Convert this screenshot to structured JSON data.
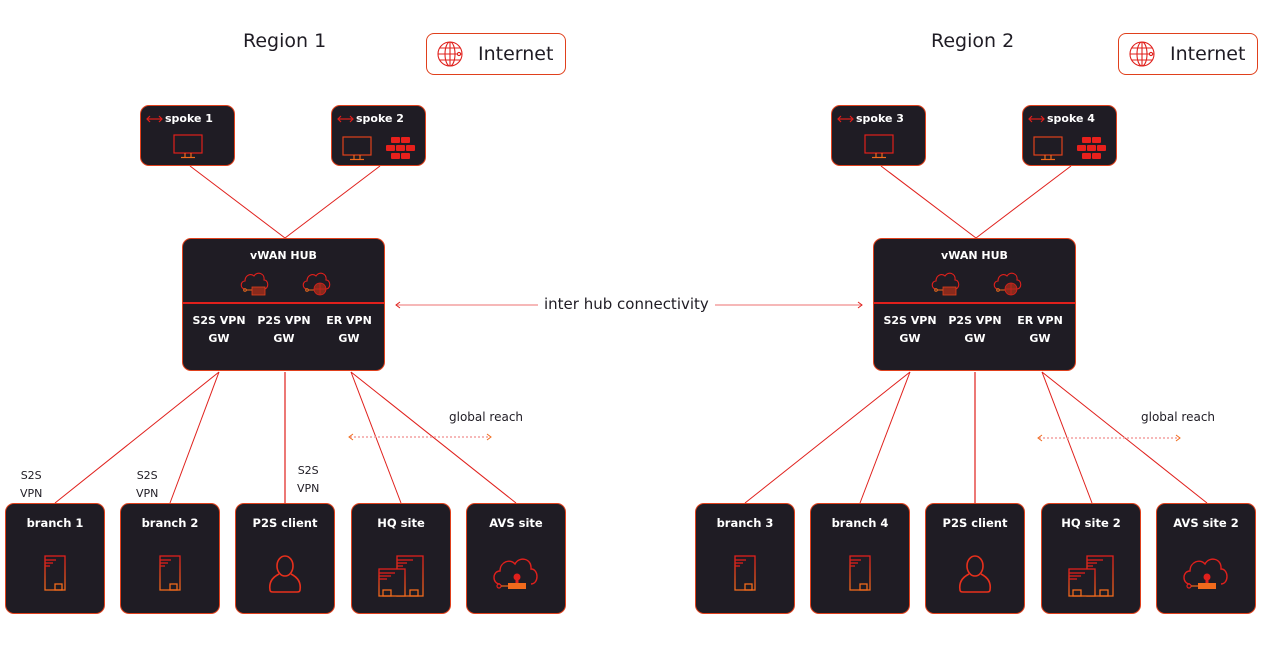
{
  "colors": {
    "accent": "#e0201c",
    "accent_orange": "#f06a1c",
    "box_bg": "#1f1c24",
    "text_dark": "#1f1c24",
    "dotted": "#f4a0a0"
  },
  "inter_hub_label": "inter hub connectivity",
  "regions": [
    {
      "title": "Region 1",
      "internet": {
        "label": "Internet",
        "icon": "globe-icon"
      },
      "spokes": [
        {
          "label": "spoke 1",
          "icons": [
            "monitor-icon"
          ]
        },
        {
          "label": "spoke 2",
          "icons": [
            "monitor-icon",
            "firewall-icon"
          ]
        }
      ],
      "hub": {
        "title": "vWAN HUB",
        "icons": [
          "cloud-firewall-icon",
          "cloud-globe-icon"
        ],
        "gateways": [
          {
            "line1": "S2S VPN",
            "line2": "GW"
          },
          {
            "line1": "P2S VPN",
            "line2": "GW"
          },
          {
            "line1": "ER VPN",
            "line2": "GW"
          }
        ]
      },
      "global_reach_label": "global reach",
      "connection_labels": [
        {
          "line1": "S2S",
          "line2": "VPN"
        },
        {
          "line1": "S2S",
          "line2": "VPN"
        },
        {
          "line1": "S2S",
          "line2": "VPN"
        }
      ],
      "sites": [
        {
          "label": "branch 1",
          "icon": "building-icon"
        },
        {
          "label": "branch 2",
          "icon": "building-icon"
        },
        {
          "label": "P2S client",
          "icon": "user-icon"
        },
        {
          "label": "HQ site",
          "icon": "buildings-icon"
        },
        {
          "label": "AVS site",
          "icon": "cloud-stamp-icon"
        }
      ]
    },
    {
      "title": "Region 2",
      "internet": {
        "label": "Internet",
        "icon": "globe-icon"
      },
      "spokes": [
        {
          "label": "spoke 3",
          "icons": [
            "monitor-icon"
          ]
        },
        {
          "label": "spoke 4",
          "icons": [
            "monitor-icon",
            "firewall-icon"
          ]
        }
      ],
      "hub": {
        "title": "vWAN HUB",
        "icons": [
          "cloud-firewall-icon",
          "cloud-globe-icon"
        ],
        "gateways": [
          {
            "line1": "S2S VPN",
            "line2": "GW"
          },
          {
            "line1": "P2S VPN",
            "line2": "GW"
          },
          {
            "line1": "ER VPN",
            "line2": "GW"
          }
        ]
      },
      "global_reach_label": "global reach",
      "sites": [
        {
          "label": "branch 3",
          "icon": "building-icon"
        },
        {
          "label": "branch 4",
          "icon": "building-icon"
        },
        {
          "label": "P2S client",
          "icon": "user-icon"
        },
        {
          "label": "HQ site 2",
          "icon": "buildings-icon"
        },
        {
          "label": "AVS site 2",
          "icon": "cloud-stamp-icon"
        }
      ]
    }
  ]
}
